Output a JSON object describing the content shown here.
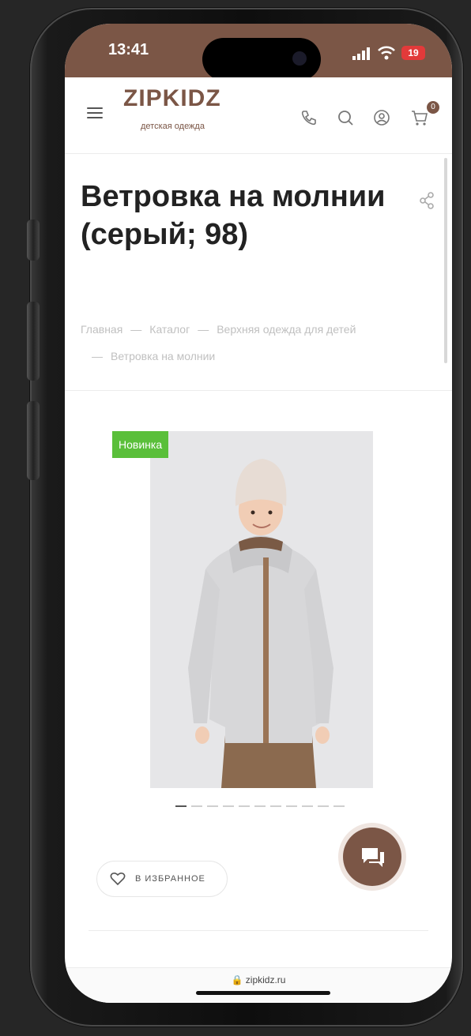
{
  "status_bar": {
    "time": "13:41",
    "battery": "19"
  },
  "header": {
    "logo": "ZIPKIDZ",
    "logo_subtitle": "детская одежда",
    "cart_count": "0",
    "icons": [
      "menu-icon",
      "phone-icon",
      "search-icon",
      "account-icon",
      "cart-icon"
    ]
  },
  "product": {
    "title": "Ветровка на молнии (серый; 98)",
    "badge": "Новинка",
    "favorite_label": "В ИЗБРАННОЕ"
  },
  "breadcrumb": {
    "items": [
      "Главная",
      "Каталог",
      "Верхняя одежда для детей",
      "Ветровка на молнии"
    ],
    "separator": "—"
  },
  "gallery": {
    "slide_count": 11,
    "active_index": 0
  },
  "browser": {
    "url": "zipkidz.ru"
  },
  "colors": {
    "brand": "#7b5646",
    "badge_green": "#5abf3a"
  }
}
